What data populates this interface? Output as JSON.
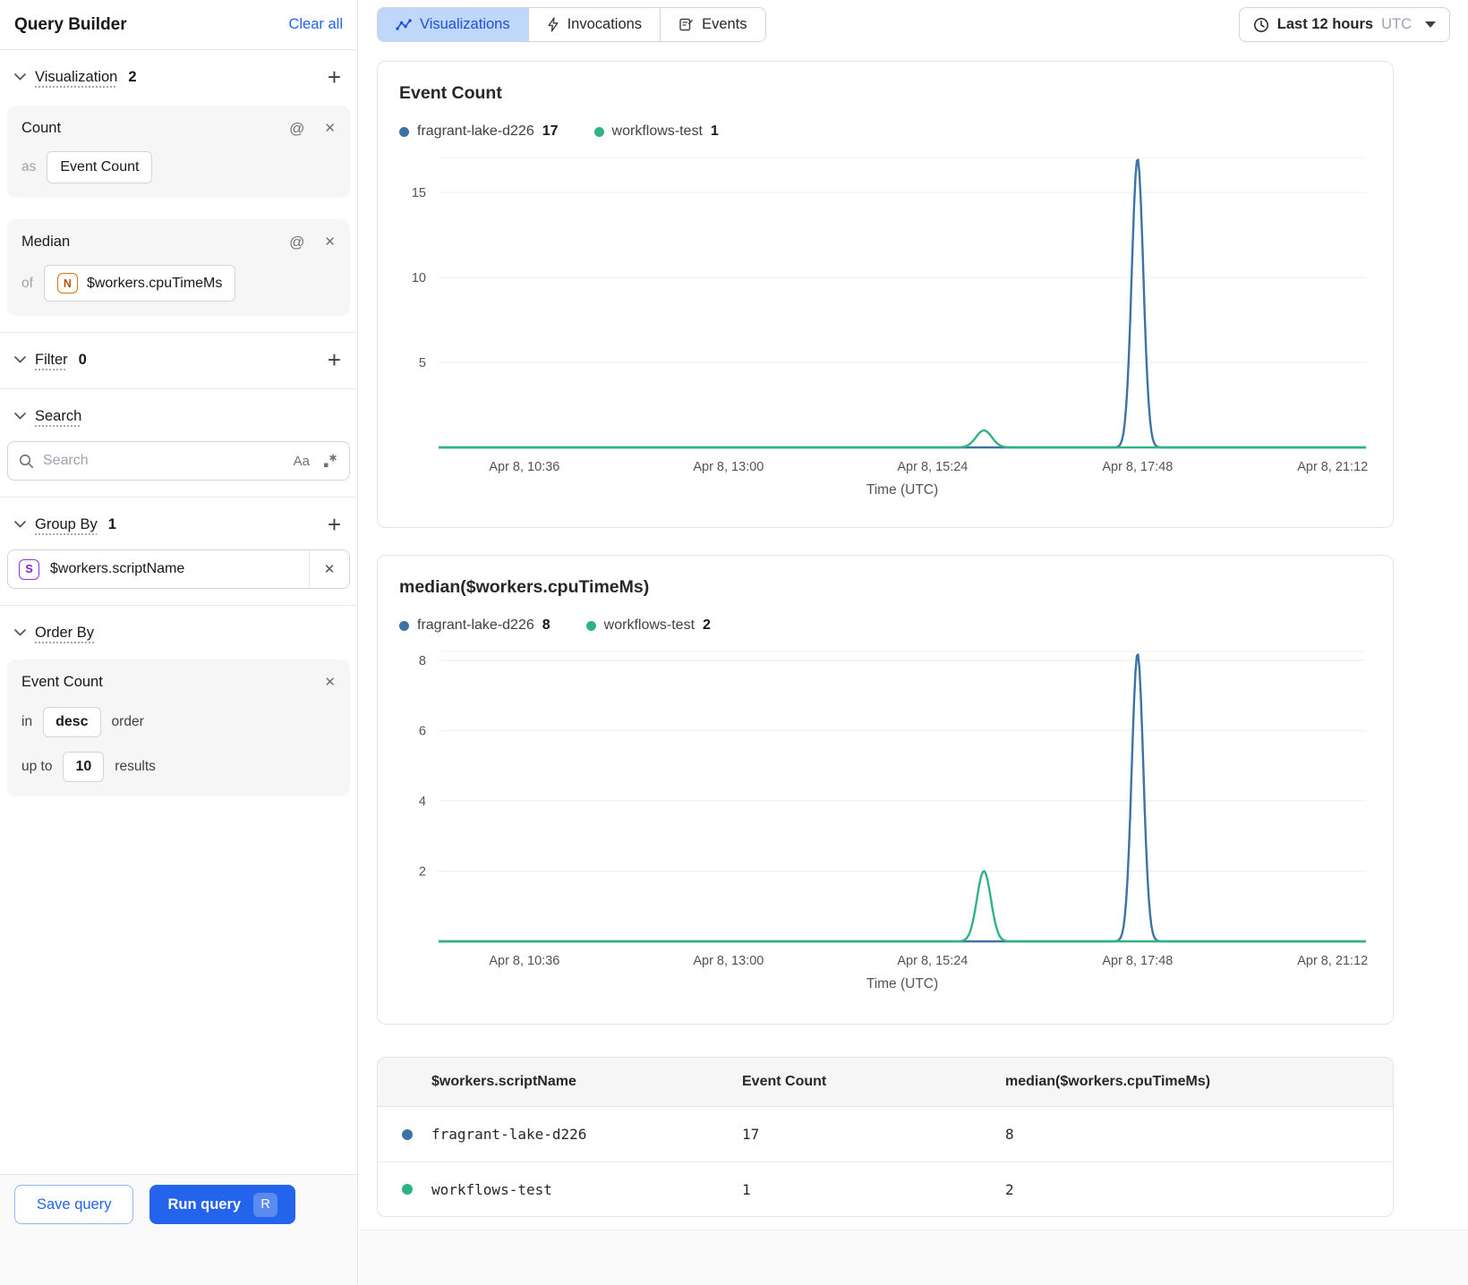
{
  "icons": {
    "at": "@",
    "close": "✕",
    "plus": "+",
    "aa": "Aa"
  },
  "sidebar": {
    "title": "Query Builder",
    "clear_all": "Clear all",
    "visualization": {
      "label": "Visualization",
      "count": "2"
    },
    "count_card": {
      "title": "Count",
      "as_label": "as",
      "value": "Event Count"
    },
    "median_card": {
      "title": "Median",
      "of_label": "of",
      "badge": "N",
      "value": "$workers.cpuTimeMs"
    },
    "filter": {
      "label": "Filter",
      "count": "0"
    },
    "search": {
      "label": "Search",
      "placeholder": "Search"
    },
    "group_by": {
      "label": "Group By",
      "count": "1",
      "item": {
        "badge": "S",
        "value": "$workers.scriptName"
      }
    },
    "order_by": {
      "label": "Order By",
      "card": {
        "title": "Event Count",
        "in_label": "in",
        "direction": "desc",
        "order_label": "order",
        "up_to_label": "up to",
        "limit": "10",
        "results_label": "results"
      }
    },
    "actions": {
      "save": "Save query",
      "run": "Run query",
      "run_shortcut": "R"
    }
  },
  "topbar": {
    "tabs": [
      {
        "label": "Visualizations",
        "active": true
      },
      {
        "label": "Invocations",
        "active": false
      },
      {
        "label": "Events",
        "active": false
      }
    ],
    "time_range": {
      "label": "Last 12 hours",
      "timezone": "UTC"
    }
  },
  "chart_data": [
    {
      "type": "line",
      "title": "Event Count",
      "xlabel": "Time (UTC)",
      "ylim": [
        0,
        17.05
      ],
      "y_ticks": [
        5,
        10,
        15
      ],
      "x_ticks": [
        "Apr 8, 10:36",
        "Apr 8, 13:00",
        "Apr 8, 15:24",
        "Apr 8, 17:48",
        "Apr 8, 21:12"
      ],
      "x_tick_fracs": [
        0.0925,
        0.3126,
        0.5327,
        0.7537,
        0.964
      ],
      "grid": true,
      "legend_position": "top",
      "series": [
        {
          "name": "fragrant-lake-d226",
          "total": "17",
          "color": "#3b73a6",
          "baseline": 0,
          "spikes": [
            {
              "c": 0.7537,
              "p": 17,
              "s": 0.0062
            }
          ]
        },
        {
          "name": "workflows-test",
          "total": "1",
          "color": "#2fb383",
          "baseline": 0,
          "spikes": [
            {
              "c": 0.588,
              "p": 1,
              "s": 0.0085
            }
          ]
        }
      ]
    },
    {
      "type": "line",
      "title": "median($workers.cpuTimeMs)",
      "xlabel": "Time (UTC)",
      "ylim": [
        0,
        8.25
      ],
      "y_ticks": [
        2,
        4,
        6,
        8
      ],
      "x_ticks": [
        "Apr 8, 10:36",
        "Apr 8, 13:00",
        "Apr 8, 15:24",
        "Apr 8, 17:48",
        "Apr 8, 21:12"
      ],
      "x_tick_fracs": [
        0.0925,
        0.3126,
        0.5327,
        0.7537,
        0.964
      ],
      "grid": true,
      "legend_position": "top",
      "series": [
        {
          "name": "fragrant-lake-d226",
          "total": "8",
          "color": "#3b73a6",
          "baseline": 0,
          "spikes": [
            {
              "c": 0.7537,
              "p": 8.2,
              "s": 0.0062
            }
          ]
        },
        {
          "name": "workflows-test",
          "total": "2",
          "color": "#2fb383",
          "baseline": 0,
          "spikes": [
            {
              "c": 0.588,
              "p": 2,
              "s": 0.0075
            }
          ]
        }
      ]
    }
  ],
  "table": {
    "columns": [
      "$workers.scriptName",
      "Event Count",
      "median($workers.cpuTimeMs)"
    ],
    "rows": [
      {
        "color": "#3b73a6",
        "name": "fragrant-lake-d226",
        "event_count": "17",
        "median": "8"
      },
      {
        "color": "#2fb383",
        "name": "workflows-test",
        "event_count": "1",
        "median": "2"
      }
    ]
  },
  "colors": {
    "accent_blue": "#2463eb",
    "active_tab_bg": "#bed7fa",
    "series_blue": "#3b73a6",
    "series_green": "#2fb383"
  }
}
